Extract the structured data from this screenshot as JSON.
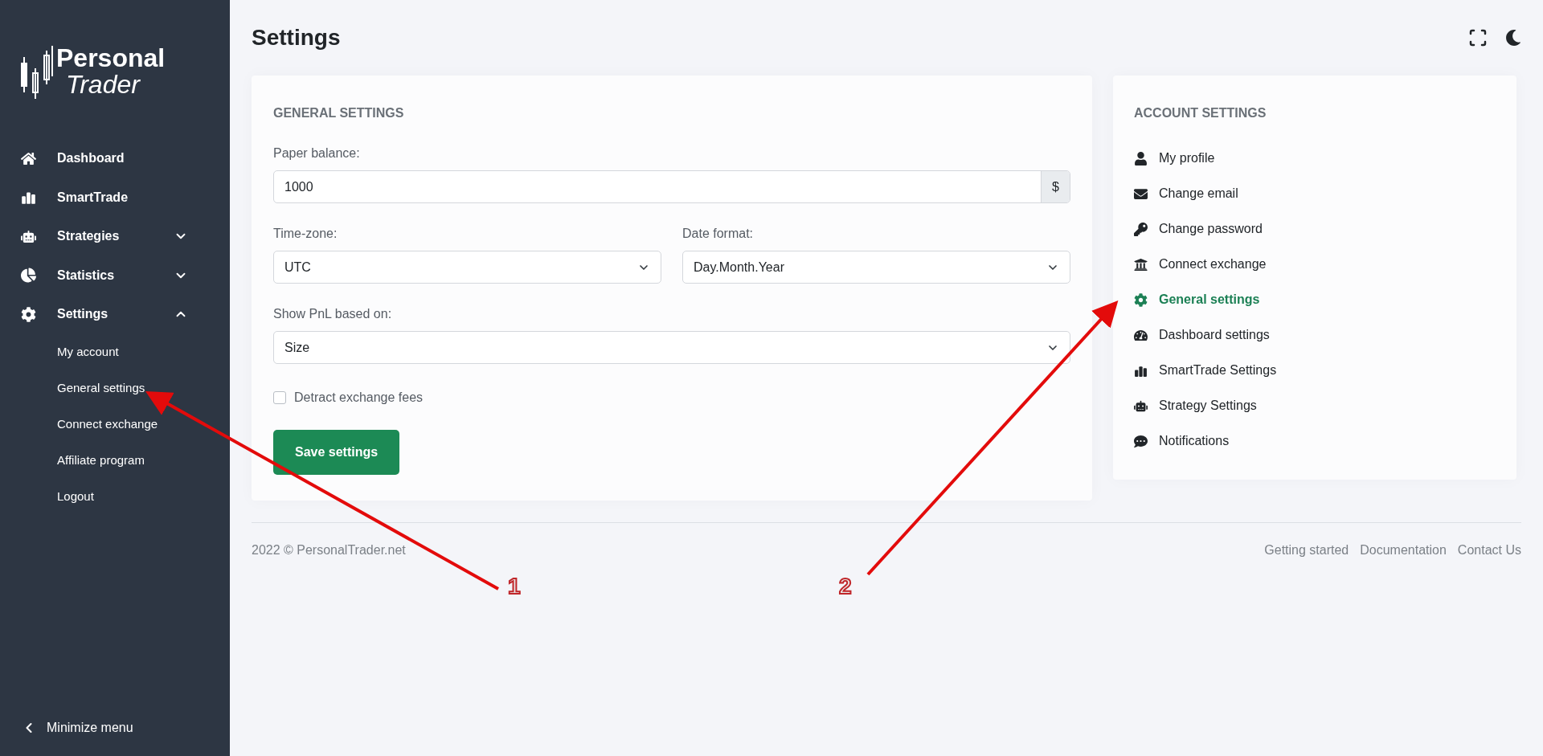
{
  "sidebar": {
    "logo": {
      "line_1": "Personal",
      "line_2": "Trader"
    },
    "items": [
      {
        "label": "Dashboard"
      },
      {
        "label": "SmartTrade"
      },
      {
        "label": "Strategies",
        "expanded": false
      },
      {
        "label": "Statistics",
        "expanded": false
      },
      {
        "label": "Settings",
        "expanded": true,
        "children": [
          {
            "label": "My account"
          },
          {
            "label": "General settings"
          },
          {
            "label": "Connect exchange"
          },
          {
            "label": "Affiliate program"
          },
          {
            "label": "Logout"
          }
        ]
      }
    ],
    "minimize": "Minimize menu"
  },
  "page_title": "Settings",
  "general_settings": {
    "title": "GENERAL SETTINGS",
    "paper_balance": {
      "label": "Paper balance:",
      "value": "1000",
      "addon": "$"
    },
    "time_zone": {
      "label": "Time-zone:",
      "value": "UTC"
    },
    "date_format": {
      "label": "Date format:",
      "value": "Day.Month.Year"
    },
    "pnl_basis": {
      "label": "Show PnL based on:",
      "value": "Size"
    },
    "detract_fees": {
      "label": "Detract exchange fees",
      "checked": false
    },
    "save_button": "Save settings"
  },
  "account_settings": {
    "title": "ACCOUNT SETTINGS",
    "items": [
      {
        "label": "My profile",
        "selected": false
      },
      {
        "label": "Change email",
        "selected": false
      },
      {
        "label": "Change password",
        "selected": false
      },
      {
        "label": "Connect exchange",
        "selected": false
      },
      {
        "label": "General settings",
        "selected": true
      },
      {
        "label": "Dashboard settings",
        "selected": false
      },
      {
        "label": "SmartTrade Settings",
        "selected": false
      },
      {
        "label": "Strategy Settings",
        "selected": false
      },
      {
        "label": "Notifications",
        "selected": false
      }
    ]
  },
  "footer": {
    "copyright": "2022 © PersonalTrader.net",
    "links": [
      "Getting started",
      "Documentation",
      "Contact Us"
    ]
  },
  "annotations": [
    {
      "label": "1"
    },
    {
      "label": "2"
    }
  ]
}
